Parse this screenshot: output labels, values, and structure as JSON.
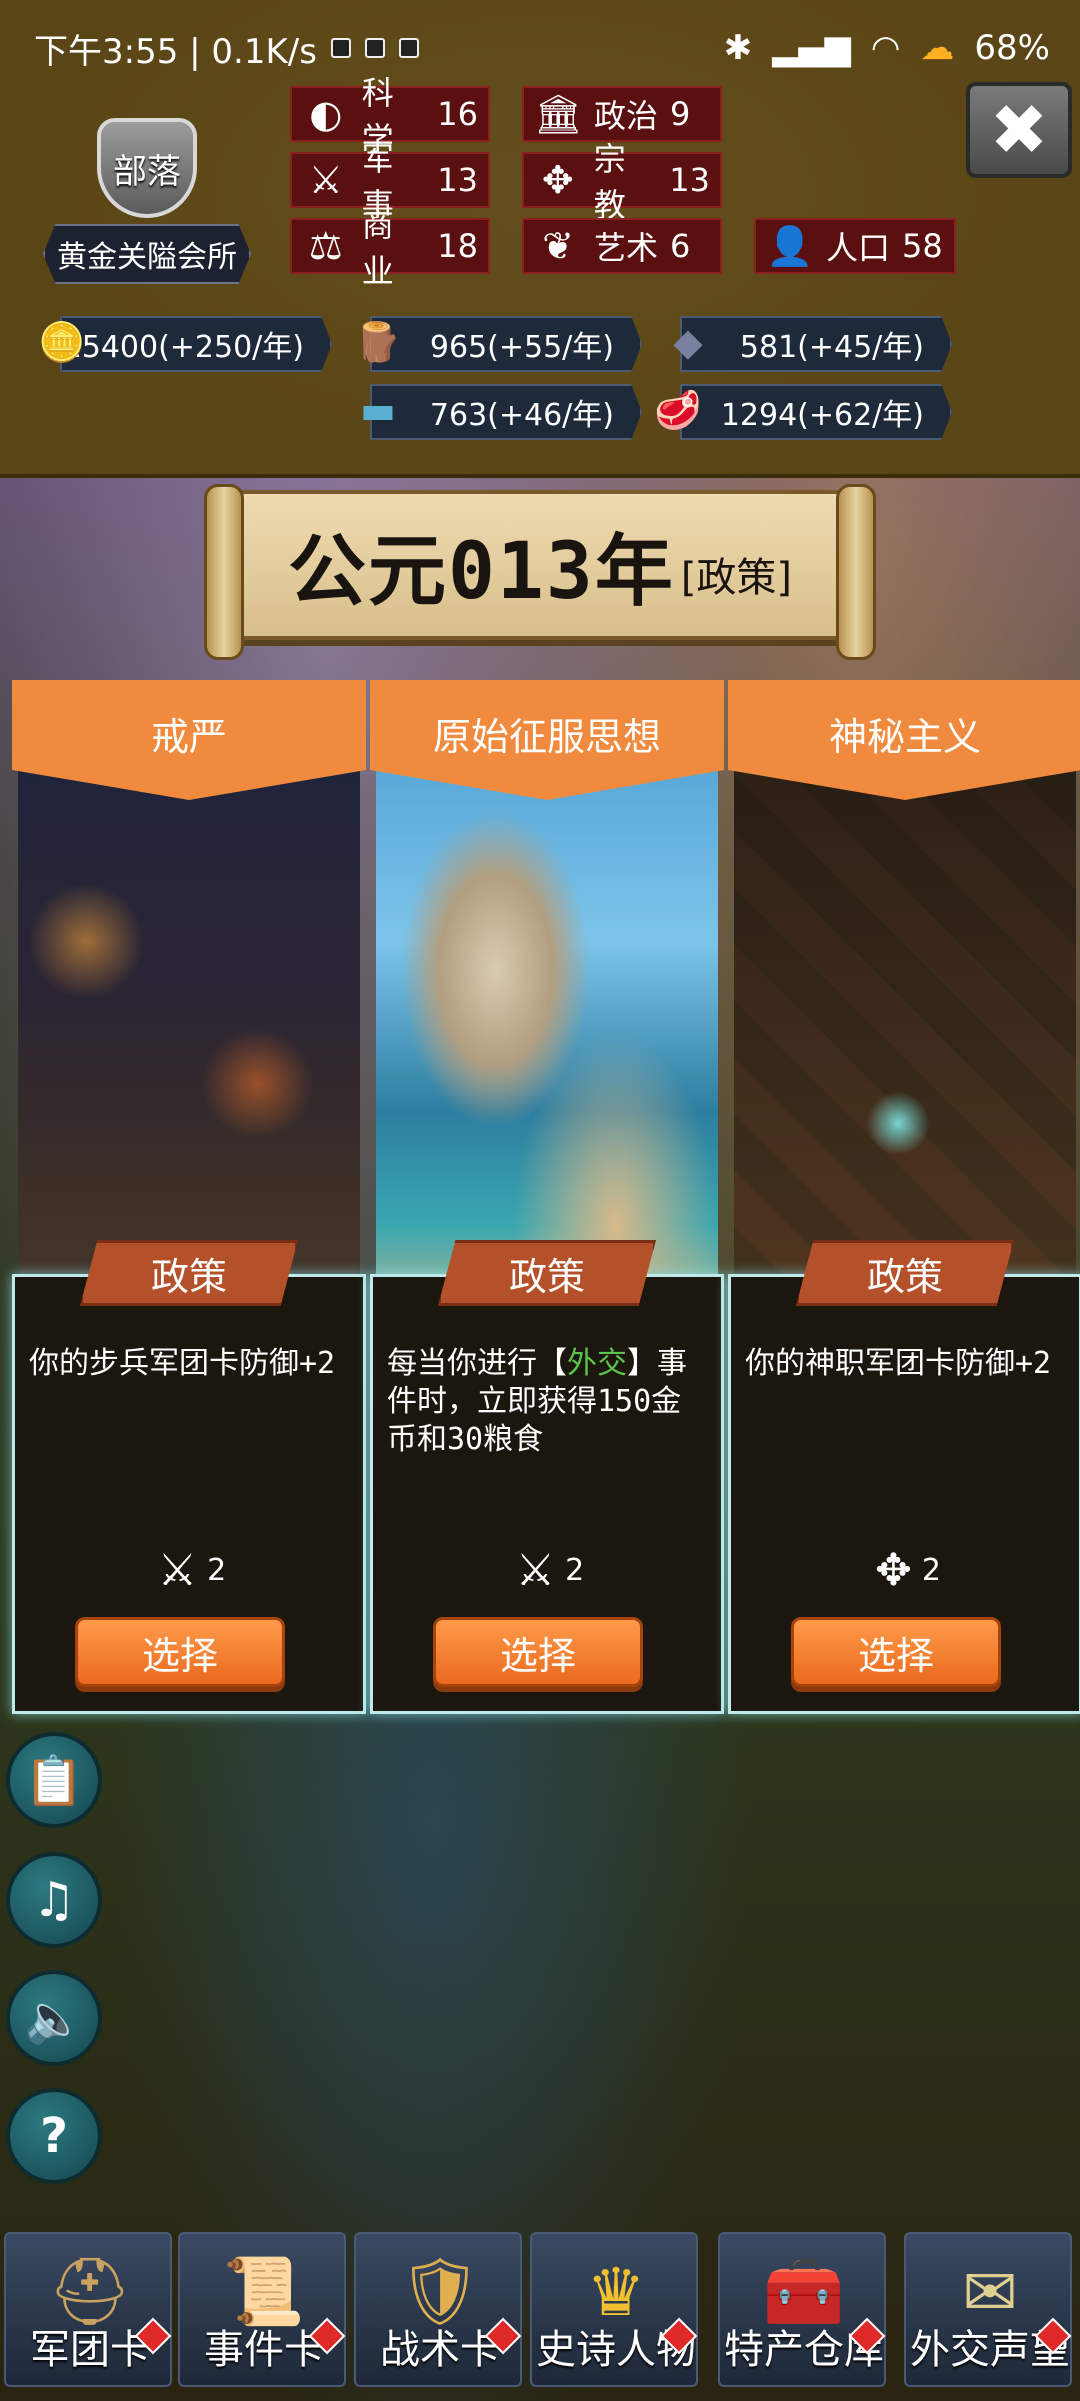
{
  "status": {
    "time_speed": "下午3:55 | 0.1K/s",
    "battery": "68%",
    "icons": [
      "bluetooth-icon",
      "signal-icon",
      "wifi-icon",
      "cloud-icon"
    ]
  },
  "tribe": {
    "rank": "部落",
    "name": "黄金关隘会所"
  },
  "stats": [
    {
      "icon": "science-icon",
      "label": "科学",
      "value": "16"
    },
    {
      "icon": "politics-icon",
      "label": "政治",
      "value": "9"
    },
    {
      "icon": "military-icon",
      "label": "军事",
      "value": "13"
    },
    {
      "icon": "religion-icon",
      "label": "宗教",
      "value": "13"
    },
    {
      "icon": "commerce-icon",
      "label": "商业",
      "value": "18"
    },
    {
      "icon": "art-icon",
      "label": "艺术",
      "value": "6"
    },
    {
      "icon": "population-icon",
      "label": "人口",
      "value": "58"
    }
  ],
  "resources": [
    {
      "icon": "gold-icon",
      "value": "15400(+250/年)"
    },
    {
      "icon": "wood-icon",
      "value": "965(+55/年)"
    },
    {
      "icon": "stone-icon",
      "value": "581(+45/年)"
    },
    {
      "icon": "iron-icon",
      "value": "763(+46/年)"
    },
    {
      "icon": "meat-icon",
      "value": "1294(+62/年)"
    }
  ],
  "banner": {
    "title": "公元013年",
    "subtitle": "[政策]"
  },
  "cards": [
    {
      "title": "戒严",
      "tag": "政策",
      "text": "你的步兵军团卡防御+2",
      "cost_icon": "military-icon",
      "cost": "2",
      "button": "选择"
    },
    {
      "title": "原始征服思想",
      "tag": "政策",
      "text_pre": "每当你进行【",
      "text_highlight": "外交",
      "text_post": "】事件时，立即获得150金币和30粮食",
      "cost_icon": "military-icon",
      "cost": "2",
      "button": "选择"
    },
    {
      "title": "神秘主义",
      "tag": "政策",
      "text": "你的神职军团卡防御+2",
      "cost_icon": "religion-icon",
      "cost": "2",
      "button": "选择"
    }
  ],
  "side_buttons": [
    "log-icon",
    "music-icon",
    "sound-icon",
    "help-icon"
  ],
  "nav": [
    {
      "icon": "helmet-icon",
      "label": "军团卡"
    },
    {
      "icon": "scroll-icon",
      "label": "事件卡"
    },
    {
      "icon": "shield-crest-icon",
      "label": "战术卡"
    },
    {
      "icon": "crown-icon",
      "label": "史诗人物"
    },
    {
      "icon": "chest-icon",
      "label": "特产仓库"
    },
    {
      "icon": "envelope-icon",
      "label": "外交声望"
    }
  ],
  "colors": {
    "header_bg": "#5a4516",
    "stat_bg": "#5a1010",
    "card_header": "#f08a3e",
    "button": "#ea6a1e",
    "highlight": "#5cc64c"
  }
}
